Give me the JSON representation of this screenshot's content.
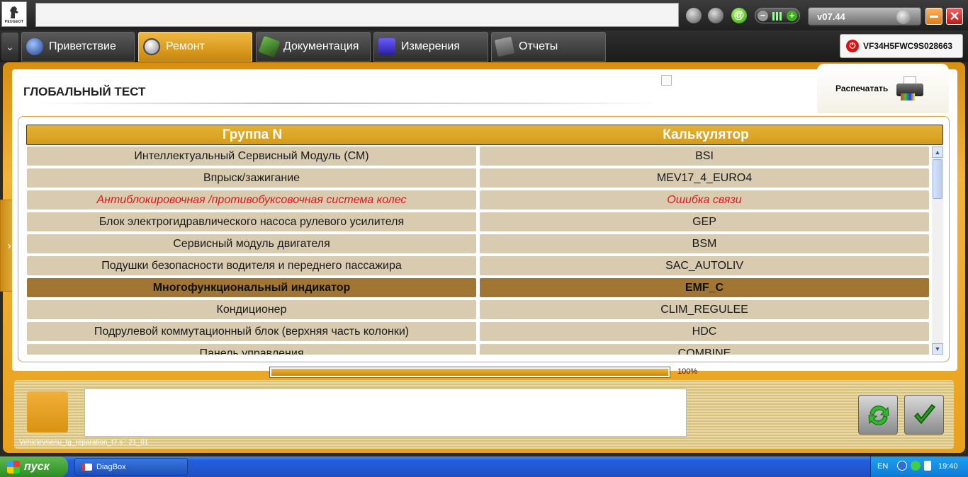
{
  "brand": {
    "logo_text": "PEUGEOT"
  },
  "topbar": {
    "version": "v07.44",
    "mail_glyph": "@"
  },
  "tabs": [
    {
      "label": "Приветствие",
      "icon": "welcome-icon"
    },
    {
      "label": "Ремонт",
      "icon": "magnifier-icon",
      "active": true
    },
    {
      "label": "Документация",
      "icon": "book-icon"
    },
    {
      "label": "Измерения",
      "icon": "wave-icon"
    },
    {
      "label": "Отчеты",
      "icon": "report-icon"
    }
  ],
  "vehicle": {
    "vin": "VF34H5FWC9S028663"
  },
  "page": {
    "title": "ГЛОБАЛЬНЫЙ ТЕСТ",
    "print_label": "Распечатать"
  },
  "table": {
    "headers": {
      "group": "Группа N",
      "calc": "Калькулятор"
    },
    "rows": [
      {
        "group": "Интеллектуальный Сервисный Модуль (СМ)",
        "calc": "BSI"
      },
      {
        "group": "Впрыск/зажигание",
        "calc": "MEV17_4_EURO4"
      },
      {
        "group": "Антиблокировочная /противобуксовочная система колес",
        "calc": "Ошибка связи",
        "error": true
      },
      {
        "group": "Блок электрогидравлического насоса рулевого усилителя",
        "calc": "GEP"
      },
      {
        "group": "Сервисный модуль двигателя",
        "calc": "BSM"
      },
      {
        "group": "Подушки безопасности водителя и переднего пассажира",
        "calc": "SAC_AUTOLIV"
      },
      {
        "group": "Многофункциональный индикатор",
        "calc": "EMF_C",
        "selected": true
      },
      {
        "group": "Кондиционер",
        "calc": "CLIM_REGULEE"
      },
      {
        "group": "Подрулевой коммутационный блок (верхняя часть колонки)",
        "calc": "HDC"
      },
      {
        "group": "Панель управления",
        "calc": "COMBINE"
      }
    ],
    "colors": {
      "error": "#e01818",
      "selected": "#a07632",
      "cell": "#d8cbb0"
    }
  },
  "progress": {
    "value": 1.0,
    "label": "100%"
  },
  "footer": {
    "path": "Vehicle\\menu_tg_reparation_t7.s : 21_01"
  },
  "taskbar": {
    "start_label": "пуск",
    "task_label": "DiagBox",
    "lang": "EN",
    "clock": "19:40"
  },
  "accent": "#e8a11c"
}
